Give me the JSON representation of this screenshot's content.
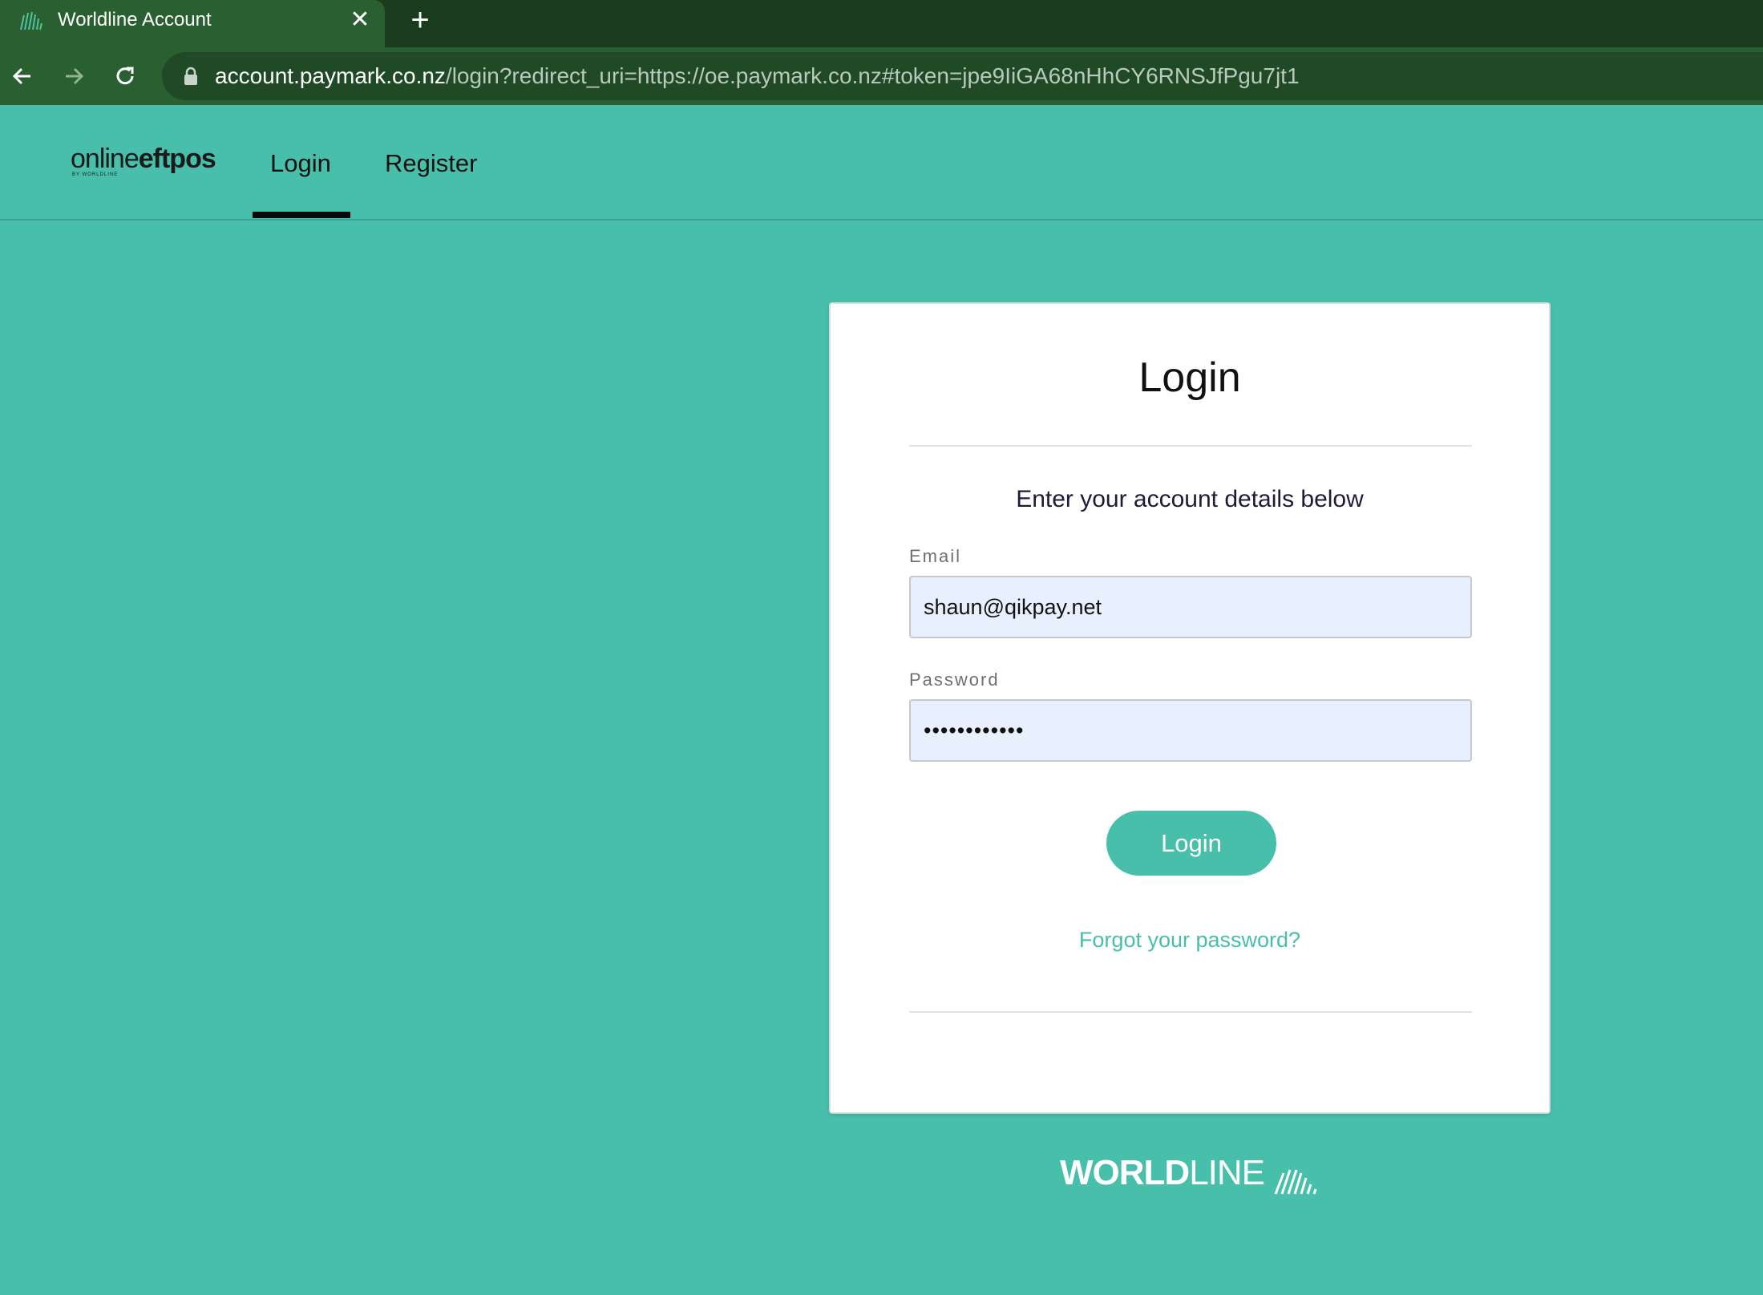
{
  "browser": {
    "tab_title": "Worldline Account",
    "tab_close": "✕",
    "new_tab": "+",
    "url_host": "account.paymark.co.nz",
    "url_path": "/login?redirect_uri=https://oe.paymark.co.nz#token=jpe9IiGA68nHhCY6RNSJfPgu7jt1"
  },
  "header": {
    "logo_light": "online",
    "logo_bold": "eftpos",
    "logo_sub": "BY WORLDLINE",
    "nav": {
      "login": "Login",
      "register": "Register"
    },
    "active_tab": "login"
  },
  "card": {
    "title": "Login",
    "subtitle": "Enter your account details below",
    "email_label": "Email",
    "email_value": "shaun@qikpay.net",
    "password_label": "Password",
    "password_value": "••••••••••••",
    "login_button": "Login",
    "forgot_link": "Forgot your password?"
  },
  "footer": {
    "brand_bold": "WORLD",
    "brand_thin": "LINE"
  },
  "colors": {
    "page_bg": "#48bfaa",
    "browser_dark": "#1b3b1f",
    "browser_green": "#2a5f31",
    "accent": "#48bfaa",
    "input_bg": "#e8f0fe"
  }
}
